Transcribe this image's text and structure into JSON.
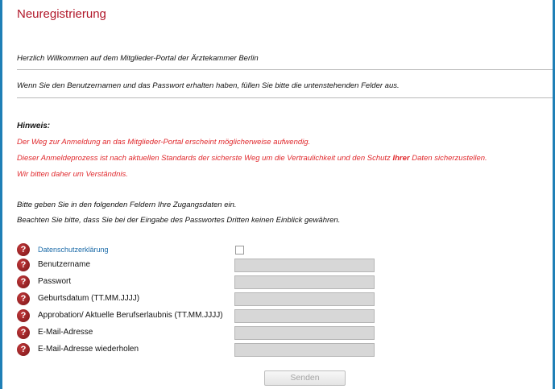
{
  "page": {
    "title": "Neuregistrierung",
    "welcome": "Herzlich Willkommen auf dem Mitglieder-Portal der Ärztekammer Berlin",
    "instruction": "Wenn Sie den Benutzernamen und das Passwort erhalten haben, füllen Sie bitte die untenstehenden Felder aus."
  },
  "hint": {
    "heading": "Hinweis:",
    "line1": "Der Weg zur Anmeldung an das Mitglieder-Portal erscheint möglicherweise aufwendig.",
    "line2_pre": "Dieser Anmeldeprozess ist nach aktuellen Standards der sicherste Weg um die Vertraulichkeit und den Schutz ",
    "line2_bold": "Ihrer",
    "line2_post": " Daten sicherzustellen.",
    "line3": "Wir bitten daher um Verständnis."
  },
  "info": {
    "line1": "Bitte geben Sie in den folgenden Feldern Ihre Zugangsdaten ein.",
    "line2": "Beachten Sie bitte, dass Sie bei der Eingabe des Passwortes Dritten keinen Einblick gewähren."
  },
  "form": {
    "help_glyph": "?",
    "privacy_label": "Datenschutzerklärung",
    "username_label": "Benutzername",
    "username_value": "",
    "password_label": "Passwort",
    "password_value": "",
    "birthdate_label": "Geburtsdatum (TT.MM.JJJJ)",
    "birthdate_value": "",
    "approbation_label": "Approbation/ Aktuelle Berufserlaubnis (TT.MM.JJJJ)",
    "approbation_value": "",
    "email_label": "E-Mail-Adresse",
    "email_value": "",
    "email_repeat_label": "E-Mail-Adresse wiederholen",
    "email_repeat_value": "",
    "submit_label": "Senden"
  }
}
